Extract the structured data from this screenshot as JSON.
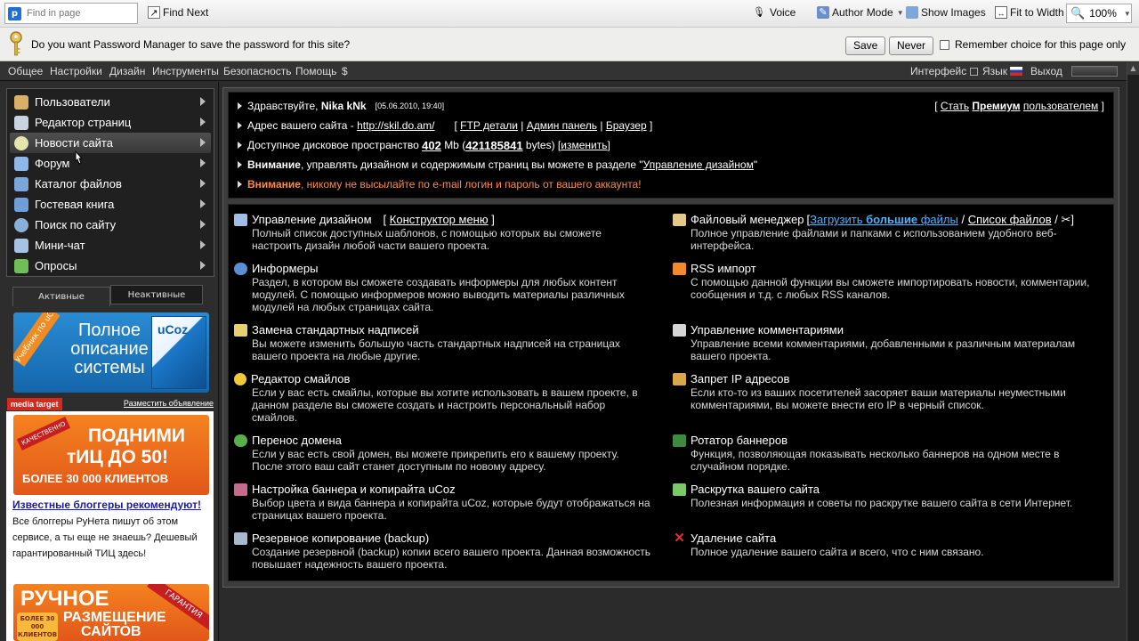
{
  "toolbar": {
    "find_placeholder": "Find in page",
    "find_next": "Find Next",
    "voice": "Voice",
    "author_mode": "Author Mode",
    "show_images": "Show Images",
    "fit_to_width": "Fit to Width",
    "zoom": "100%"
  },
  "password_bar": {
    "message": "Do you want Password Manager to save the password for this site?",
    "save": "Save",
    "never": "Never",
    "remember": "Remember choice for this page only"
  },
  "nav": {
    "items": [
      "Общее",
      "Настройки",
      "Дизайн",
      "Инструменты",
      "Безопасность",
      "Помощь",
      "$"
    ],
    "interface": "Интерфейс",
    "language": "Язык",
    "logout": "Выход"
  },
  "sidebar": {
    "menu": [
      {
        "label": "Пользователи",
        "icon": "users-icon",
        "color": "#d9b066"
      },
      {
        "label": "Редактор страниц",
        "icon": "page-editor-icon",
        "color": "#c9d2de"
      },
      {
        "label": "Новости сайта",
        "icon": "news-icon",
        "color": "#e4e4ad"
      },
      {
        "label": "Форум",
        "icon": "forum-icon",
        "color": "#8fb7e8"
      },
      {
        "label": "Каталог файлов",
        "icon": "file-catalog-icon",
        "color": "#7aa7db"
      },
      {
        "label": "Гостевая книга",
        "icon": "guestbook-icon",
        "color": "#6f9fd8"
      },
      {
        "label": "Поиск по сайту",
        "icon": "search-icon",
        "color": "#8ab0d8"
      },
      {
        "label": "Мини-чат",
        "icon": "minichat-icon",
        "color": "#a7c3e4"
      },
      {
        "label": "Опросы",
        "icon": "polls-icon",
        "color": "#6fbf54"
      }
    ],
    "tabs": {
      "active": "Активные",
      "inactive": "Неактивные"
    },
    "banner1_text": [
      "Полное",
      "описание",
      "системы"
    ],
    "banner1_ribbon": "Учебник по uCoz",
    "banner1_logo": "uCoz",
    "ad_label": "media target",
    "ad_link": "Разместить объявление",
    "banner2_text": [
      "ПОДНИМИ",
      "тИЦ ДО 50!",
      "БОЛЕЕ 30 000 КЛИЕНТОВ"
    ],
    "banner2_ribbon": "КАЧЕСТВЕННО",
    "promo_title": "Известные блоггеры рекомендуют!",
    "promo_text": "Все блоггеры РуНета пишут об этом сервисе, а ты еще не знаешь? Дешевый гарантированный ТИЦ здесь!",
    "banner3_text": [
      "РУЧНОЕ",
      "РАЗМЕЩЕНИЕ",
      "САЙТОВ"
    ],
    "banner3_badge": "БОЛЕЕ 30 000 КЛИЕНТОВ",
    "banner3_ribbon": "ГАРАНТИЯ"
  },
  "info": {
    "greeting": "Здравствуйте,",
    "user": "Nika kNk",
    "date": "[05.06.2010, 19:40]",
    "premium_prefix": "[",
    "premium_1": "Стать",
    "premium_2": "Премиум",
    "premium_3": "пользователем",
    "premium_suffix": "]",
    "site_label": "Адрес вашего сайта -",
    "site_url": "http://skil.do.am/",
    "ftp": "FTP детали",
    "admin": "Админ панель",
    "browser": "Браузер",
    "disk_label": "Доступное дисковое пространство",
    "disk_mb": "402",
    "disk_mb_unit": "Mb",
    "disk_bytes": "421185841",
    "disk_bytes_unit": "bytes",
    "change": "изменить",
    "attention1_bold": "Внимание",
    "attention1": ", управлять дизайном и содержимым страниц вы можете в разделе \"",
    "attention1_link": "Управление дизайном",
    "attention1_end": "\"",
    "attention2_bold": "Внимание",
    "attention2": ", никому не высылайте по e-mail логин и пароль от вашего аккаунта!",
    "warn_color": "#ff8a3d"
  },
  "features_left": [
    {
      "title": "Управление дизайном",
      "extra_prefix": "[",
      "extra": "Конструктор меню",
      "extra_suffix": "]",
      "desc": "Полный список доступных шаблонов, с помощью которых вы сможете настроить дизайн любой части вашего проекта.",
      "icon": "design-icon",
      "color": "#9fbde6"
    },
    {
      "title": "Информеры",
      "desc": "Раздел, в котором вы сможете создавать информеры для любых контент модулей. С помощью информеров можно выводить материалы различных модулей на любых страницах сайта.",
      "icon": "informers-icon",
      "color": "#5a8fd6"
    },
    {
      "title": "Замена стандартных надписей",
      "desc": "Вы можете изменить большую часть стандартных надписей на страницах вашего проекта на любые другие.",
      "icon": "labels-icon",
      "color": "#e8cf70"
    },
    {
      "title": "Редактор смайлов",
      "desc": "Если у вас есть смайлы, которые вы хотите использовать в вашем проекте, в данном разделе вы сможете создать и настроить персональный набор смайлов.",
      "icon": "smiley-icon",
      "color": "#f3c93a"
    },
    {
      "title": "Перенос домена",
      "desc": "Если у вас есть свой домен, вы можете прикрепить его к вашему проекту. После этого ваш сайт станет доступным по новому адресу.",
      "icon": "domain-icon",
      "color": "#59b04a"
    },
    {
      "title": "Настройка баннера и копирайта uCoz",
      "desc": "Выбор цвета и вида баннера и копирайта uCoz, которые будут отображаться на страницах вашего проекта.",
      "icon": "banner-settings-icon",
      "color": "#c76a8c"
    },
    {
      "title": "Резервное копирование (backup)",
      "desc": "Создание резервной (backup) копии всего вашего проекта. Данная возможность повышает надежность вашего проекта.",
      "icon": "backup-icon",
      "color": "#a8b9cf"
    }
  ],
  "features_right": [
    {
      "title": "Файловый менеджер",
      "desc": "Полное управление файлами и папками с использованием удобного веб-интерфейса.",
      "icon": "file-manager-icon",
      "color": "#e2c98a"
    },
    {
      "title": "RSS импорт",
      "desc": "С помощью данной функции вы сможете импортировать новости, комментарии, сообщения и т.д. с любых RSS каналов.",
      "icon": "rss-icon",
      "color": "#f08a2c"
    },
    {
      "title": "Управление комментариями",
      "desc": "Управление всеми комментариями, добавленными к различным материалам вашего проекта.",
      "icon": "comments-icon",
      "color": "#d7d7d7"
    },
    {
      "title": "Запрет IP адресов",
      "desc": "Если кто-то из ваших посетителей засоряет ваши материалы неуместными комментариями, вы можете внести его IP в черный список.",
      "icon": "ip-ban-icon",
      "color": "#d9a84b"
    },
    {
      "title": "Ротатор баннеров",
      "desc": "Функция, позволяющая показывать несколько баннеров на одном месте в случайном порядке.",
      "icon": "rotator-icon",
      "color": "#3f8a3f"
    },
    {
      "title": "Раскрутка вашего сайта",
      "desc": "Полезная информация и советы по раскрутке вашего сайта в сети Интернет.",
      "icon": "promotion-icon",
      "color": "#7cc96a"
    },
    {
      "title": "Удаление сайта",
      "desc": "Полное удаление вашего сайта и всего, что с ним связано.",
      "icon": "delete-icon",
      "color": "#e03030"
    }
  ],
  "file_manager_links": {
    "prefix": "[",
    "upload_1": "Загрузить",
    "upload_2": "большие",
    "upload_3": "файлы",
    "sep": "/",
    "list": "Список файлов",
    "sep2": "/",
    "end": "]"
  }
}
